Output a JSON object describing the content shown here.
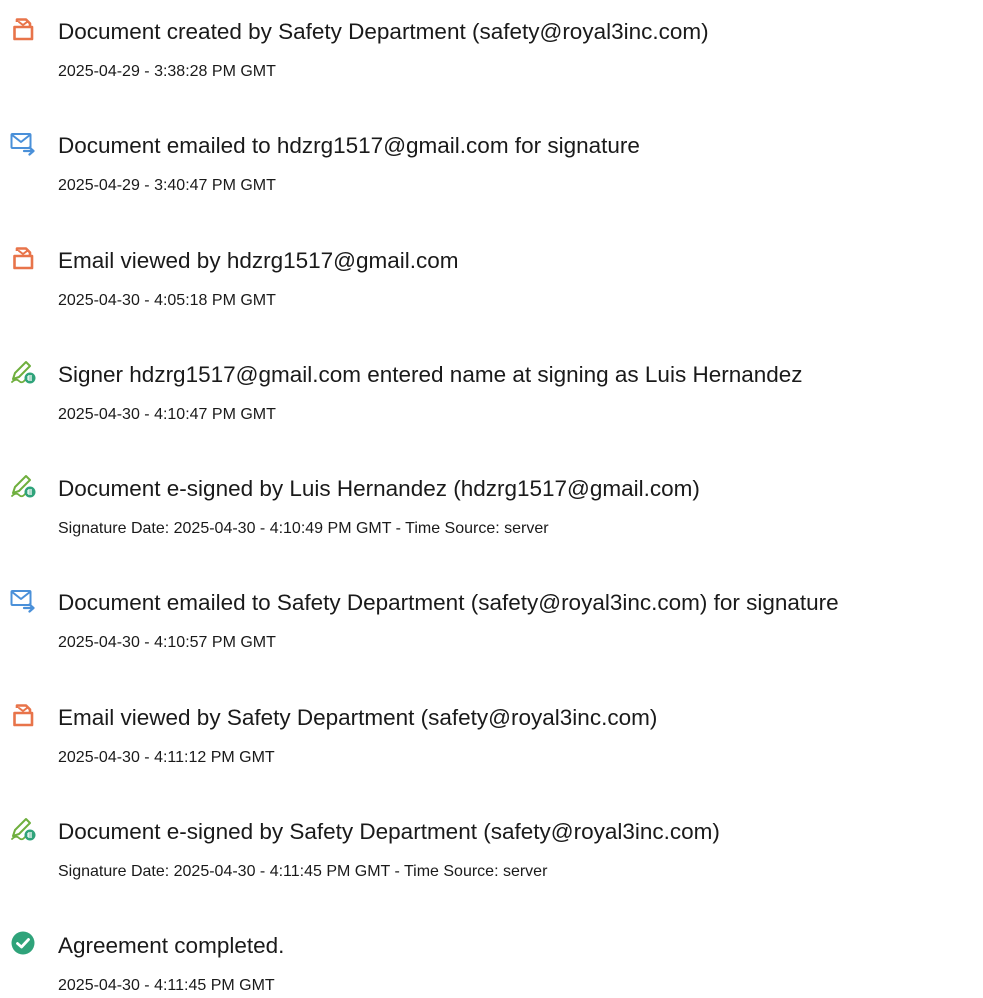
{
  "colors": {
    "created_icon": "#E8744A",
    "email_icon": "#4A90D9",
    "esign_icon": "#67B84A",
    "completed_icon": "#2FA37A",
    "text": "#1A1A1A"
  },
  "events": [
    {
      "icon": "document-icon",
      "title": "Document created by Safety Department (safety@royal3inc.com)",
      "detail": "2025-04-29 - 3:38:28 PM GMT"
    },
    {
      "icon": "email-send-icon",
      "title": "Document emailed to hdzrg1517@gmail.com for signature",
      "detail": "2025-04-29 - 3:40:47 PM GMT"
    },
    {
      "icon": "document-icon",
      "title": "Email viewed by hdzrg1517@gmail.com",
      "detail": "2025-04-30 - 4:05:18 PM GMT"
    },
    {
      "icon": "esign-pen-icon",
      "title": "Signer hdzrg1517@gmail.com entered name at signing as Luis Hernandez",
      "detail": "2025-04-30 - 4:10:47 PM GMT"
    },
    {
      "icon": "esign-pen-icon",
      "title": "Document e-signed by Luis Hernandez (hdzrg1517@gmail.com)",
      "detail": "Signature Date: 2025-04-30 - 4:10:49 PM GMT - Time Source: server"
    },
    {
      "icon": "email-send-icon",
      "title": "Document emailed to Safety Department (safety@royal3inc.com) for signature",
      "detail": "2025-04-30 - 4:10:57 PM GMT"
    },
    {
      "icon": "document-icon",
      "title": "Email viewed by Safety Department (safety@royal3inc.com)",
      "detail": "2025-04-30 - 4:11:12 PM GMT"
    },
    {
      "icon": "esign-pen-icon",
      "title": "Document e-signed by Safety Department (safety@royal3inc.com)",
      "detail": "Signature Date: 2025-04-30 - 4:11:45 PM GMT - Time Source: server"
    },
    {
      "icon": "checkmark-circle-icon",
      "title": "Agreement completed.",
      "detail": "2025-04-30 - 4:11:45 PM GMT"
    }
  ]
}
